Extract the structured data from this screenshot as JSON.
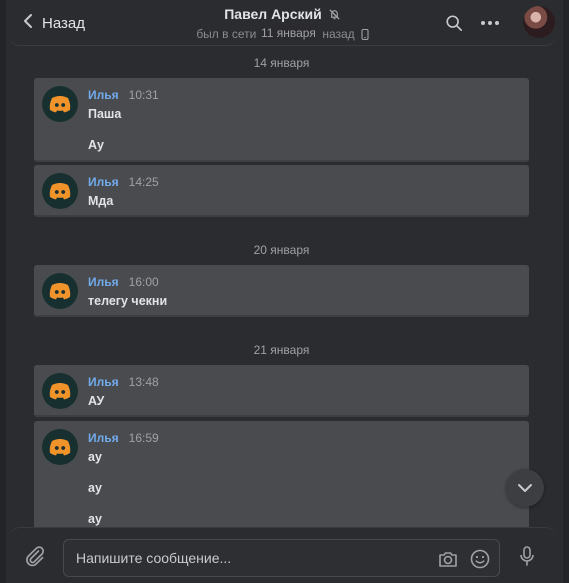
{
  "header": {
    "back_label": "Назад",
    "title": "Павел Арский",
    "status": "был в сети",
    "status_tail": "назад",
    "sticky_date": "11 января"
  },
  "composer": {
    "placeholder": "Напишите сообщение..."
  },
  "groups": [
    {
      "date": "14 января",
      "messages": [
        {
          "author": "Илья",
          "time": "10:31",
          "lines": [
            "Паша",
            "Ау"
          ]
        },
        {
          "author": "Илья",
          "time": "14:25",
          "lines": [
            "Мда"
          ]
        }
      ]
    },
    {
      "date": "20 января",
      "messages": [
        {
          "author": "Илья",
          "time": "16:00",
          "lines": [
            "телегу чекни"
          ]
        }
      ]
    },
    {
      "date": "21 января",
      "messages": [
        {
          "author": "Илья",
          "time": "13:48",
          "lines": [
            "АУ"
          ]
        },
        {
          "author": "Илья",
          "time": "16:59",
          "lines": [
            "ау",
            "ау",
            "ау"
          ]
        }
      ]
    }
  ],
  "colors": {
    "background": "#2b2c2f",
    "bubble": "#4a4b4f",
    "author": "#71aaeb",
    "discord_orange": "#f0932b",
    "avatar_bg": "#17302f"
  },
  "icons": {
    "back": "chevron-left-icon",
    "mute": "muted-bell-icon",
    "phone": "mobile-phone-icon",
    "search": "search-icon",
    "more": "more-dots-icon",
    "scroll": "chevron-down-icon",
    "attach": "paperclip-icon",
    "camera": "camera-icon",
    "emoji": "smile-icon",
    "mic": "microphone-icon"
  }
}
